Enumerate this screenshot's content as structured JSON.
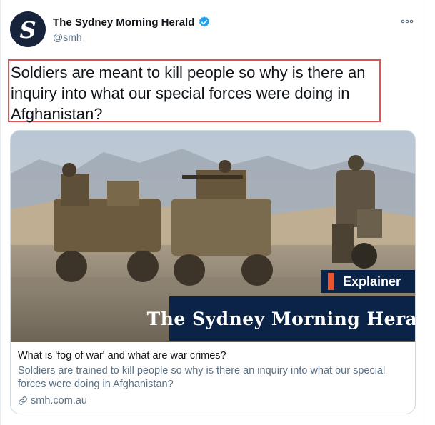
{
  "account": {
    "display_name": "The Sydney Morning Herald",
    "handle": "@smh",
    "avatar_letter": "S",
    "verified": true
  },
  "tweet": {
    "text": "Soldiers are meant to kill people so why is there an inquiry into what our special forces were doing in Afghanistan?"
  },
  "card": {
    "badge_label": "Explainer",
    "brand_banner": "The Sydney Morning Herald",
    "title": "What is 'fog of war' and what are war crimes?",
    "description": "Soldiers are trained to kill people so why is there an inquiry into what our special forces were doing in Afghanistan?",
    "domain": "smh.com.au"
  },
  "colors": {
    "accent_verified": "#1da1f2",
    "highlight_border": "#e05252",
    "brand_navy": "#0b2346",
    "explainer_orange": "#e8552f"
  }
}
